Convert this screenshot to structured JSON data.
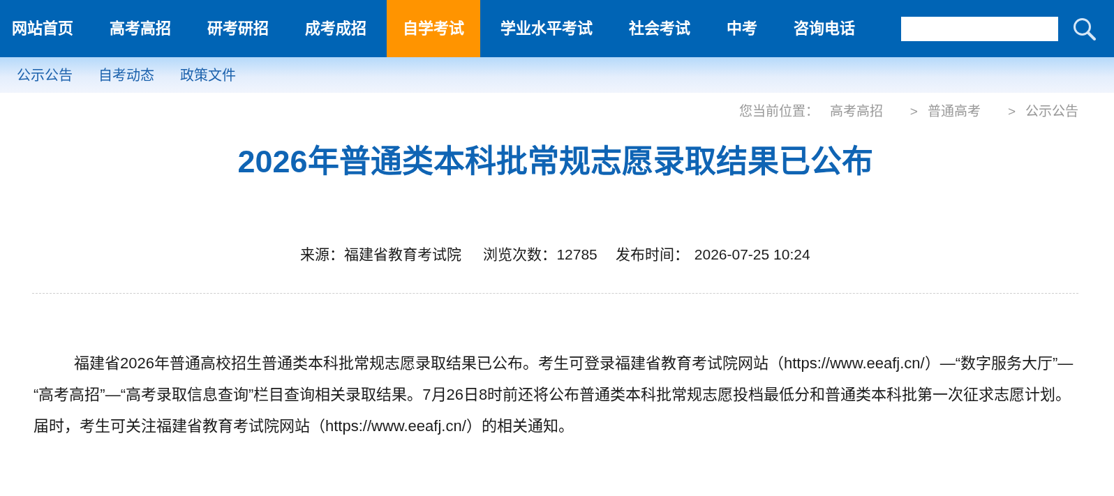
{
  "nav": {
    "items": [
      {
        "label": "网站首页",
        "selected": false
      },
      {
        "label": "高考高招",
        "selected": false
      },
      {
        "label": "研考研招",
        "selected": false
      },
      {
        "label": "成考成招",
        "selected": false
      },
      {
        "label": "自学考试",
        "selected": true
      },
      {
        "label": "学业水平考试",
        "selected": false
      },
      {
        "label": "社会考试",
        "selected": false
      },
      {
        "label": "中考",
        "selected": false
      },
      {
        "label": "咨询电话",
        "selected": false
      }
    ]
  },
  "subnav": {
    "items": [
      "公示公告",
      "自考动态",
      "政策文件"
    ]
  },
  "breadcrumb": {
    "label": "您当前位置：",
    "trail": [
      {
        "kind": "link",
        "text": "高考高招"
      },
      {
        "kind": "separator",
        "text": ">"
      },
      {
        "kind": "link",
        "text": "普通高考"
      },
      {
        "kind": "separator",
        "text": ">"
      },
      {
        "kind": "link",
        "text": "公示公告"
      }
    ]
  },
  "article": {
    "title": "2026年普通类本科批常规志愿录取结果已公布",
    "meta": {
      "source": "来源：福建省教育考试院",
      "views": "浏览次数：12785",
      "published_label": "发布时间：",
      "published": "2026-07-25 10:24"
    },
    "paragraphs": [
      "福建省2026年普通高校招生普通类本科批常规志愿录取结果已公布。考生可登录福建省教育考试院网站（https://www.eeafj.cn/）—“数字服务大厅”—“高考高招”—“高考录取信息查询”栏目查询相关录取结果。7月26日8时前还将公布普通类本科批常规志愿投档最低分和普通类本科批第一次征求志愿计划。届时，考生可关注福建省教育考试院网站（https://www.eeafj.cn/）的相关通知。"
    ]
  }
}
